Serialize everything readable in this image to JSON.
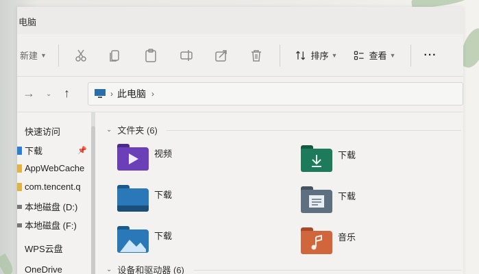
{
  "window": {
    "title": "电脑"
  },
  "toolbar": {
    "new_label": "新建",
    "sort_label": "排序",
    "view_label": "查看",
    "more_label": "···"
  },
  "address": {
    "location": "此电脑"
  },
  "sidebar": {
    "items": [
      {
        "label": "快速访问",
        "icon": "star-icon",
        "color": ""
      },
      {
        "label": "下载",
        "icon": "download-icon",
        "color": "#2b7fd4"
      },
      {
        "label": "AppWebCache",
        "icon": "folder-icon",
        "color": "#e3b341"
      },
      {
        "label": "com.tencent.q",
        "icon": "folder-icon",
        "color": "#e3b341"
      },
      {
        "label": "本地磁盘 (D:)",
        "icon": "drive-icon",
        "color": "#777777"
      },
      {
        "label": "本地磁盘 (F:)",
        "icon": "drive-icon",
        "color": "#777777"
      },
      {
        "label": "WPS云盘",
        "icon": "cloud-icon",
        "color": ""
      },
      {
        "label": "OneDrive",
        "icon": "cloud-icon",
        "color": ""
      }
    ]
  },
  "groups": {
    "folders_heading": "文件夹 (6)",
    "devices_heading": "设备和驱动器 (6)"
  },
  "folders": [
    {
      "label": "视频",
      "icon": "video-folder-icon",
      "color": "#6b3fb8"
    },
    {
      "label": "下载",
      "icon": "download-folder-icon",
      "color": "#1d7a5b"
    },
    {
      "label": "下载",
      "icon": "desktop-folder-icon",
      "color": "#2a78b8"
    },
    {
      "label": "下载",
      "icon": "documents-folder-icon",
      "color": "#5e6f80"
    },
    {
      "label": "下载",
      "icon": "pictures-folder-icon",
      "color": "#2a78b8"
    },
    {
      "label": "音乐",
      "icon": "music-folder-icon",
      "color": "#d1653b"
    }
  ]
}
